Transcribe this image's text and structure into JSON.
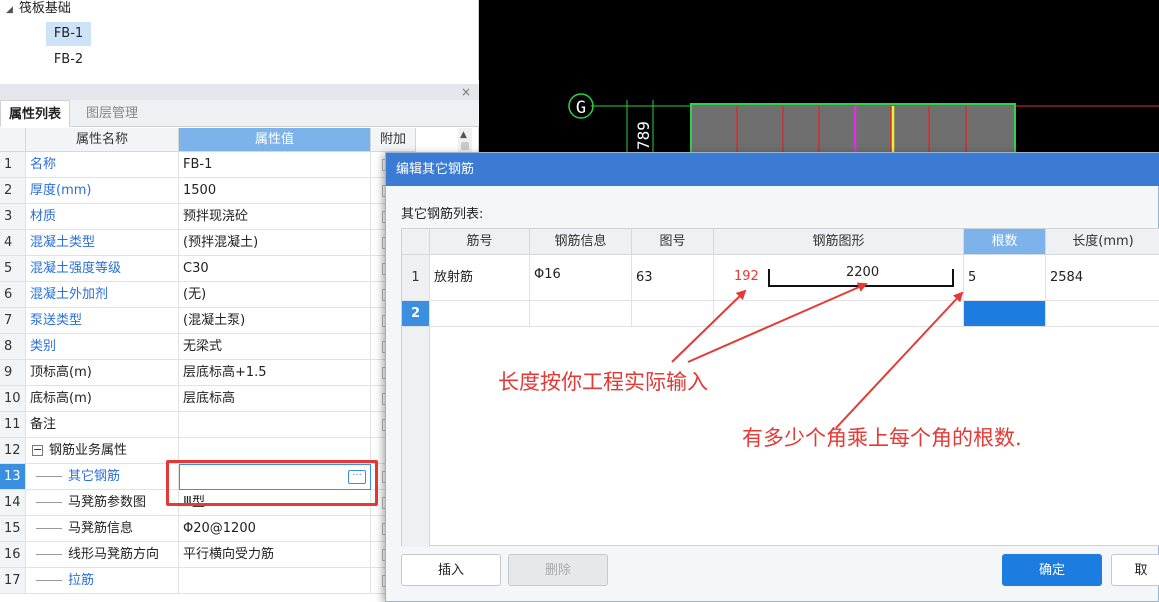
{
  "tree": {
    "root_label": "筏板基础",
    "items": [
      {
        "label": "FB-1",
        "selected": true
      },
      {
        "label": "FB-2",
        "selected": false
      }
    ]
  },
  "panel": {
    "close_glyph": "×",
    "tabs": [
      {
        "label": "属性列表",
        "active": true
      },
      {
        "label": "图层管理",
        "active": false
      }
    ],
    "columns": {
      "name": "属性名称",
      "value": "属性值",
      "extra": "附加"
    },
    "rows": [
      {
        "num": "1",
        "name": "名称",
        "value": "FB-1",
        "blue": true
      },
      {
        "num": "2",
        "name": "厚度(mm)",
        "value": "1500",
        "blue": true
      },
      {
        "num": "3",
        "name": "材质",
        "value": "预拌现浇砼",
        "blue": true
      },
      {
        "num": "4",
        "name": "混凝土类型",
        "value": "(预拌混凝土)",
        "blue": true
      },
      {
        "num": "5",
        "name": "混凝土强度等级",
        "value": "C30",
        "blue": true
      },
      {
        "num": "6",
        "name": "混凝土外加剂",
        "value": "(无)",
        "blue": true
      },
      {
        "num": "7",
        "name": "泵送类型",
        "value": "(混凝土泵)",
        "blue": true
      },
      {
        "num": "8",
        "name": "类别",
        "value": "无梁式",
        "blue": true
      },
      {
        "num": "9",
        "name": "顶标高(m)",
        "value": "层底标高+1.5",
        "blue": false
      },
      {
        "num": "10",
        "name": "底标高(m)",
        "value": "层底标高",
        "blue": false
      },
      {
        "num": "11",
        "name": "备注",
        "value": "",
        "blue": false
      },
      {
        "num": "12",
        "name": "钢筋业务属性",
        "value": "",
        "blue": false,
        "group": true,
        "toggle": "−"
      },
      {
        "num": "13",
        "name": "其它钢筋",
        "value": "",
        "blue": true,
        "child": true,
        "selected": true,
        "editing": true,
        "button": "···"
      },
      {
        "num": "14",
        "name": "马凳筋参数图",
        "value": "Ⅲ型",
        "blue": false,
        "child": true
      },
      {
        "num": "15",
        "name": "马凳筋信息",
        "value": "Φ20@1200",
        "blue": false,
        "child": true
      },
      {
        "num": "16",
        "name": "线形马凳筋方向",
        "value": "平行横向受力筋",
        "blue": false,
        "child": true
      },
      {
        "num": "17",
        "name": "拉筋",
        "value": "",
        "blue": true,
        "child": true
      }
    ]
  },
  "cad": {
    "axis_label": "G",
    "dim_text": "789"
  },
  "dialog": {
    "title": "编辑其它钢筋",
    "list_label": "其它钢筋列表:",
    "columns": [
      "筋号",
      "钢筋信息",
      "图号",
      "钢筋图形",
      "根数",
      "长度(mm)"
    ],
    "rows": [
      {
        "num": "1",
        "bar_name": "放射筋",
        "bar_info": "Φ16",
        "shape_no": "63",
        "shape_left": "192",
        "shape_main": "2200",
        "count": "5",
        "length": "2584"
      },
      {
        "num": "2",
        "bar_name": "",
        "bar_info": "",
        "shape_no": "",
        "shape_left": "",
        "shape_main": "",
        "count": "",
        "length": ""
      }
    ],
    "buttons": {
      "insert": "插入",
      "delete": "删除",
      "ok": "确定",
      "cancel": "取"
    }
  },
  "annotations": {
    "length_note": "长度按你工程实际输入",
    "count_note": "有多少个角乘上每个角的根数."
  },
  "colors": {
    "accent": "#1d7ce0",
    "annotation": "#e53935",
    "header_selected": "#7cb3ea",
    "cad_bg": "#000000"
  }
}
